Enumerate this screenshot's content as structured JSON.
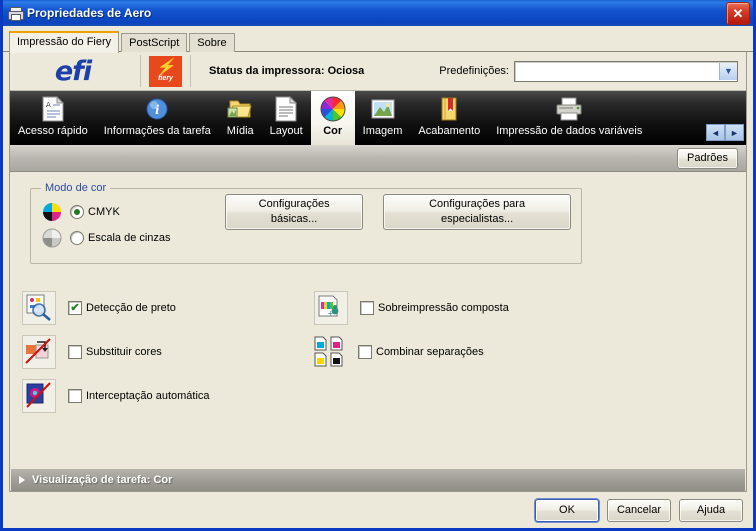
{
  "window": {
    "title": "Propriedades de Aero",
    "title_icon": "printer-icon",
    "close_label": "✕",
    "accent_title_color": "#0B43BE",
    "accent_tab_color": "#F0A000",
    "background_color": "#ECE9DA"
  },
  "tabs": [
    {
      "label": "Impressão do Fiery",
      "active": true
    },
    {
      "label": "PostScript",
      "active": false
    },
    {
      "label": "Sobre",
      "active": false
    }
  ],
  "brand": {
    "efi_logo_text": "efi",
    "fiery_logo_bolt": "⚡",
    "fiery_logo_word": "fiery",
    "fiery_logo_color": "#E8491C",
    "status_text": "Status da impressora: Ociosa",
    "presets_label": "Predefinições:",
    "presets_value": "",
    "presets_placeholder": ""
  },
  "toolbar": {
    "items": [
      {
        "label": "Acesso rápido",
        "icon": "document-lines-icon",
        "active": false
      },
      {
        "label": "Informações da tarefa",
        "icon": "info-circle-icon",
        "active": false
      },
      {
        "label": "Mídia",
        "icon": "folder-media-icon",
        "active": false
      },
      {
        "label": "Layout",
        "icon": "page-layout-icon",
        "active": false
      },
      {
        "label": "Cor",
        "icon": "color-wheel-icon",
        "active": true
      },
      {
        "label": "Imagem",
        "icon": "picture-icon",
        "active": false
      },
      {
        "label": "Acabamento",
        "icon": "booklet-icon",
        "active": false
      },
      {
        "label": "Impressão de dados variáveis",
        "icon": "printer-icon",
        "active": false
      }
    ],
    "scroll_left": "◄",
    "scroll_right": "►"
  },
  "defaults_bar": {
    "defaults_button": "Padrões"
  },
  "color_mode_group": {
    "title": "Modo de cor",
    "options": [
      {
        "label": "CMYK",
        "selected": true,
        "icon": "cmyk-pie-icon"
      },
      {
        "label": "Escala de cinzas",
        "selected": false,
        "icon": "grayscale-pie-icon"
      }
    ],
    "basic_settings_button": "Configurações básicas...",
    "expert_settings_button": "Configurações para especialistas..."
  },
  "options_left": [
    {
      "label": "Detecção de preto",
      "checked": true,
      "icon": "black-detect-magnifier-icon",
      "check_glyph": "✔"
    },
    {
      "label": "Substituir cores",
      "checked": false,
      "icon": "replace-colors-icon",
      "check_glyph": ""
    },
    {
      "label": "Interceptação automática",
      "checked": false,
      "icon": "auto-trapping-icon",
      "check_glyph": ""
    }
  ],
  "options_right": [
    {
      "label": "Sobreimpressão composta",
      "checked": false,
      "icon": "composite-overprint-icon",
      "check_glyph": ""
    },
    {
      "label": "Combinar separações",
      "checked": false,
      "icon": "combine-separations-icon",
      "check_glyph": ""
    }
  ],
  "preview_bar": {
    "label": "Visualização de tarefa: Cor"
  },
  "footer": {
    "ok": "OK",
    "cancel": "Cancelar",
    "help": "Ajuda"
  }
}
